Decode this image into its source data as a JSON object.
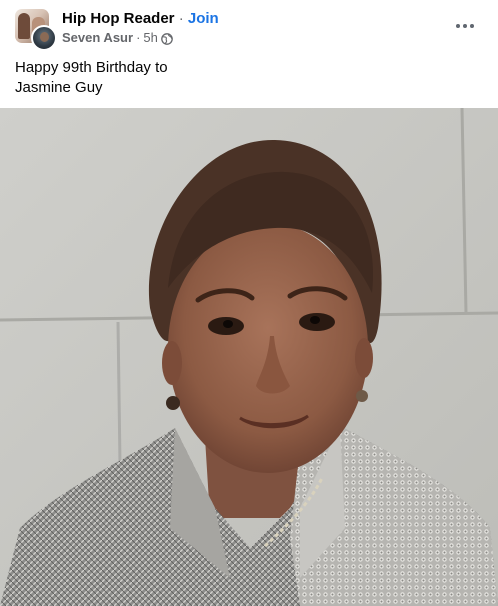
{
  "post": {
    "group_name": "Hip Hop Reader",
    "separator": "·",
    "join_label": "Join",
    "author": "Seven Asur",
    "time": "5h",
    "text_line1": "Happy 99th Birthday to",
    "text_line2": "Jasmine Guy"
  },
  "icons": {
    "privacy": "globe-icon",
    "more": "more-options-icon"
  },
  "colors": {
    "join_link": "#1b74e4",
    "meta_text": "#65676b"
  }
}
